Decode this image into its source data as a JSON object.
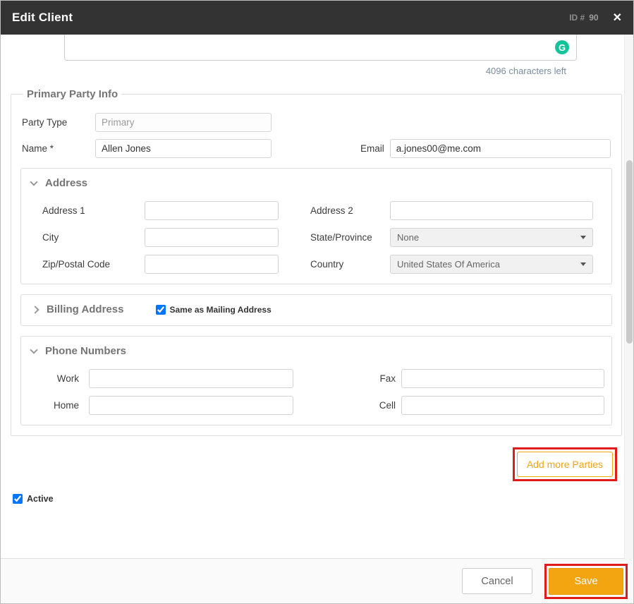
{
  "header": {
    "title": "Edit Client",
    "id_label": "ID #",
    "id_value": "90"
  },
  "icons": {
    "close": "✕",
    "grammarly": "G"
  },
  "notes": {
    "chars_left": "4096 characters left"
  },
  "party": {
    "legend": "Primary Party Info",
    "party_type": {
      "label": "Party Type",
      "value": "Primary"
    },
    "name": {
      "label": "Name *",
      "value": "Allen Jones"
    },
    "email": {
      "label": "Email",
      "value": "a.jones00@me.com"
    },
    "address": {
      "title": "Address",
      "address1_label": "Address 1",
      "address2_label": "Address 2",
      "city_label": "City",
      "state": {
        "label": "State/Province",
        "value": "None"
      },
      "zip_label": "Zip/Postal Code",
      "country": {
        "label": "Country",
        "value": "United States Of America"
      }
    },
    "billing": {
      "title": "Billing Address",
      "same_label": "Same as Mailing Address"
    },
    "phones": {
      "title": "Phone Numbers",
      "work_label": "Work",
      "fax_label": "Fax",
      "home_label": "Home",
      "cell_label": "Cell"
    }
  },
  "actions": {
    "add_parties": "Add more Parties",
    "active": "Active",
    "cancel": "Cancel",
    "save": "Save"
  },
  "colors": {
    "accent_orange": "#f2a411",
    "annotation_red": "#e01b1b",
    "header_bg": "#333333",
    "grammarly_green": "#15c39a"
  }
}
